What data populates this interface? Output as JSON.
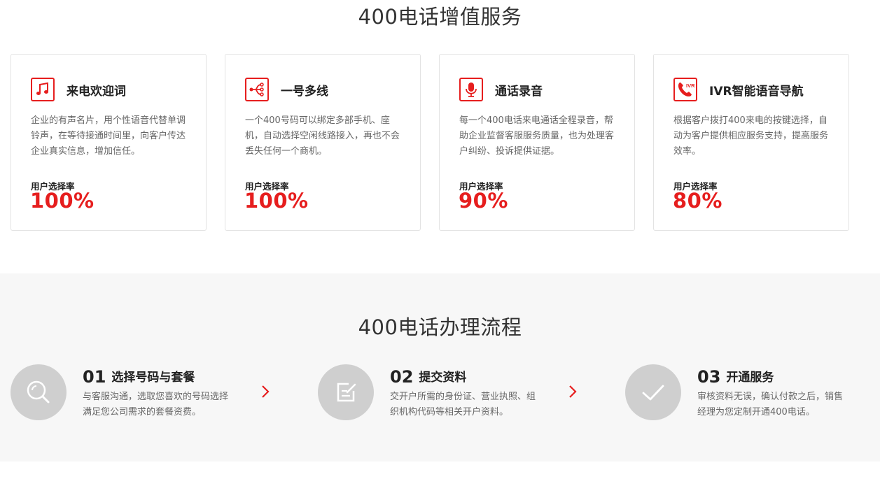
{
  "services": {
    "title": "400电话增值服务",
    "cards": [
      {
        "icon": "music-note-icon",
        "title": "来电欢迎词",
        "desc": "企业的有声名片，用个性语音代替单调铃声，在等待接通时间里，向客户传达企业真实信息，增加信任。",
        "rate_label": "用户选择率",
        "rate": "100%"
      },
      {
        "icon": "share-branch-icon",
        "title": "一号多线",
        "desc": "一个400号码可以绑定多部手机、座机，自动选择空闲线路接入，再也不会丢失任何一个商机。",
        "rate_label": "用户选择率",
        "rate": "100%"
      },
      {
        "icon": "microphone-icon",
        "title": "通话录音",
        "desc": "每一个400电话来电通话全程录音，帮助企业监督客服服务质量，也为处理客户纠纷、投诉提供证据。",
        "rate_label": "用户选择率",
        "rate": "90%"
      },
      {
        "icon": "ivr-phone-icon",
        "icon_text": "IVR",
        "title": "IVR智能语音导航",
        "desc": "根据客户拨打400来电的按键选择，自动为客户提供相应服务支持，提高服务效率。",
        "rate_label": "用户选择率",
        "rate": "80%"
      }
    ]
  },
  "process": {
    "title": "400电话办理流程",
    "steps": [
      {
        "icon": "search-icon",
        "num": "01",
        "title": "选择号码与套餐",
        "desc": "与客服沟通，选取您喜欢的号码选择满足您公司需求的套餐资费。"
      },
      {
        "icon": "edit-document-icon",
        "num": "02",
        "title": "提交资料",
        "desc": "交开户所需的身份证、营业执照、组织机构代码等相关开户资料。"
      },
      {
        "icon": "checkmark-icon",
        "num": "03",
        "title": "开通服务",
        "desc": "审核资料无误，确认付款之后，销售经理为您定制开通400电话。"
      }
    ]
  },
  "colors": {
    "accent": "#e61e1e",
    "process_bg": "#f7f7f7",
    "circle": "#cfcfcf"
  }
}
